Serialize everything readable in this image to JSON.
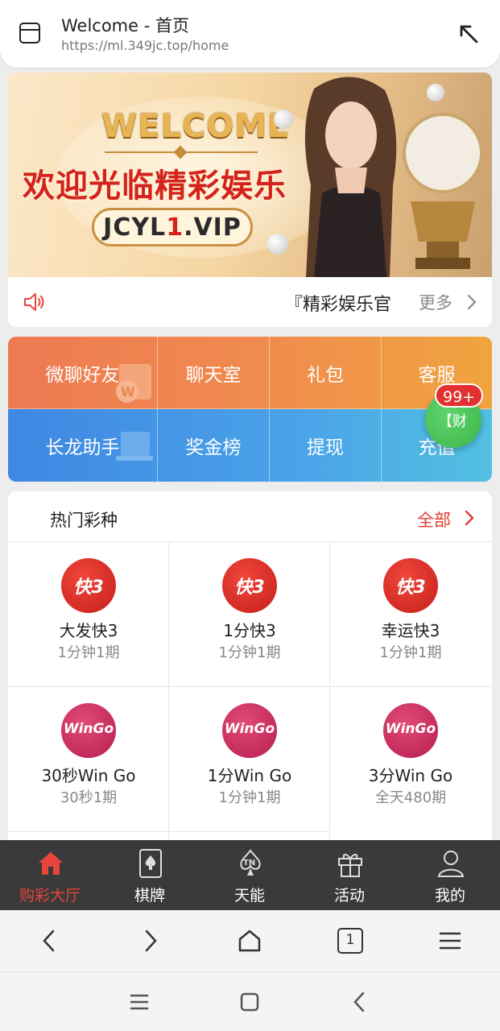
{
  "browser": {
    "title": "Welcome - 首页",
    "url": "https://ml.349jc.top/home"
  },
  "banner": {
    "welcome": "WELCOME",
    "headline": "欢迎光临精彩娱乐",
    "domain_prefix": "JCYL",
    "domain_accent": "1",
    "domain_suffix": ".VIP"
  },
  "notice": {
    "text": "『精彩娱乐官",
    "more": "更多"
  },
  "quick_menu": {
    "row1": [
      "微聊好友",
      "聊天室",
      "礼包",
      "客服"
    ],
    "row2": [
      "长龙助手",
      "奖金榜",
      "提现",
      "充值"
    ]
  },
  "floating_badge": {
    "count": "99+",
    "text": "【财"
  },
  "hot": {
    "title": "热门彩种",
    "all": "全部",
    "games": [
      {
        "icon": "k3-dice-icon",
        "glyph": "快3",
        "name": "大发快3",
        "sub": "1分钟1期"
      },
      {
        "icon": "k3-dice-icon",
        "glyph": "快3",
        "name": "1分快3",
        "sub": "1分钟1期"
      },
      {
        "icon": "k3-dice-icon",
        "glyph": "快3",
        "name": "幸运快3",
        "sub": "1分钟1期"
      },
      {
        "icon": "wingo-icon",
        "glyph": "WinGo",
        "name": "30秒Win Go",
        "sub": "30秒1期"
      },
      {
        "icon": "wingo-icon",
        "glyph": "WinGo",
        "name": "1分Win Go",
        "sub": "1分钟1期"
      },
      {
        "icon": "wingo-icon",
        "glyph": "WinGo",
        "name": "3分Win Go",
        "sub": "全天480期"
      }
    ]
  },
  "bottom_nav": [
    {
      "label": "购彩大厅",
      "icon": "home-icon",
      "active": true
    },
    {
      "label": "棋牌",
      "icon": "cards-icon",
      "active": false
    },
    {
      "label": "天能",
      "icon": "tn-spade-icon",
      "active": false
    },
    {
      "label": "活动",
      "icon": "gift-icon",
      "active": false
    },
    {
      "label": "我的",
      "icon": "user-icon",
      "active": false
    }
  ],
  "browser_nav": {
    "tab_count": "1"
  },
  "colors": {
    "accent_red": "#e8453c",
    "nav_bg": "#3a3a3a",
    "orange_row": "#f08a4f",
    "blue_row": "#4aa3e8",
    "badge_green": "#3bb54a"
  }
}
